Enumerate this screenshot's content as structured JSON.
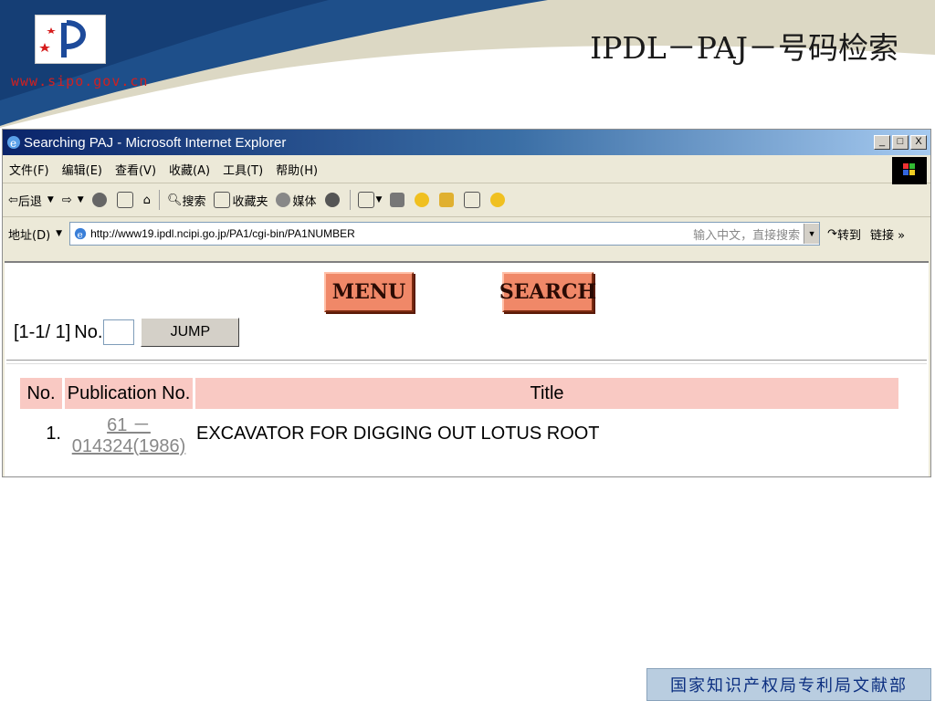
{
  "slide": {
    "title": "IPDL－PAJ－号码检索",
    "site_url": "www.sipo.gov.cn",
    "footer": "国家知识产权局专利局文献部"
  },
  "window": {
    "title": "Searching PAJ - Microsoft Internet Explorer",
    "controls": [
      "_",
      "□",
      "X"
    ]
  },
  "menu": [
    "文件(F)",
    "编辑(E)",
    "查看(V)",
    "收藏(A)",
    "工具(T)",
    "帮助(H)"
  ],
  "toolbar": {
    "back": "后退",
    "search": "搜索",
    "favorites": "收藏夹",
    "media": "媒体"
  },
  "address": {
    "label": "地址(D)",
    "url": "http://www19.ipdl.ncipi.go.jp/PA1/cgi-bin/PA1NUMBER",
    "hint": "输入中文，直接搜索",
    "go": "转到",
    "links": "链接"
  },
  "page": {
    "menu_button": "MENU",
    "search_button": "SEARCH",
    "range": "[1-1/ 1]",
    "no_label": "No.",
    "jump_button": "JUMP",
    "table": {
      "headers": [
        "No.",
        "Publication No.",
        "Title"
      ],
      "rows": [
        {
          "no": "1.",
          "pub": "61 － 014324(1986)",
          "title": "EXCAVATOR FOR DIGGING OUT LOTUS ROOT"
        }
      ]
    }
  },
  "colors": {
    "title_bar": "#0a246a",
    "button_face": "#f08868",
    "table_header": "#f9c9c3",
    "footer_text": "#0c2f80"
  }
}
